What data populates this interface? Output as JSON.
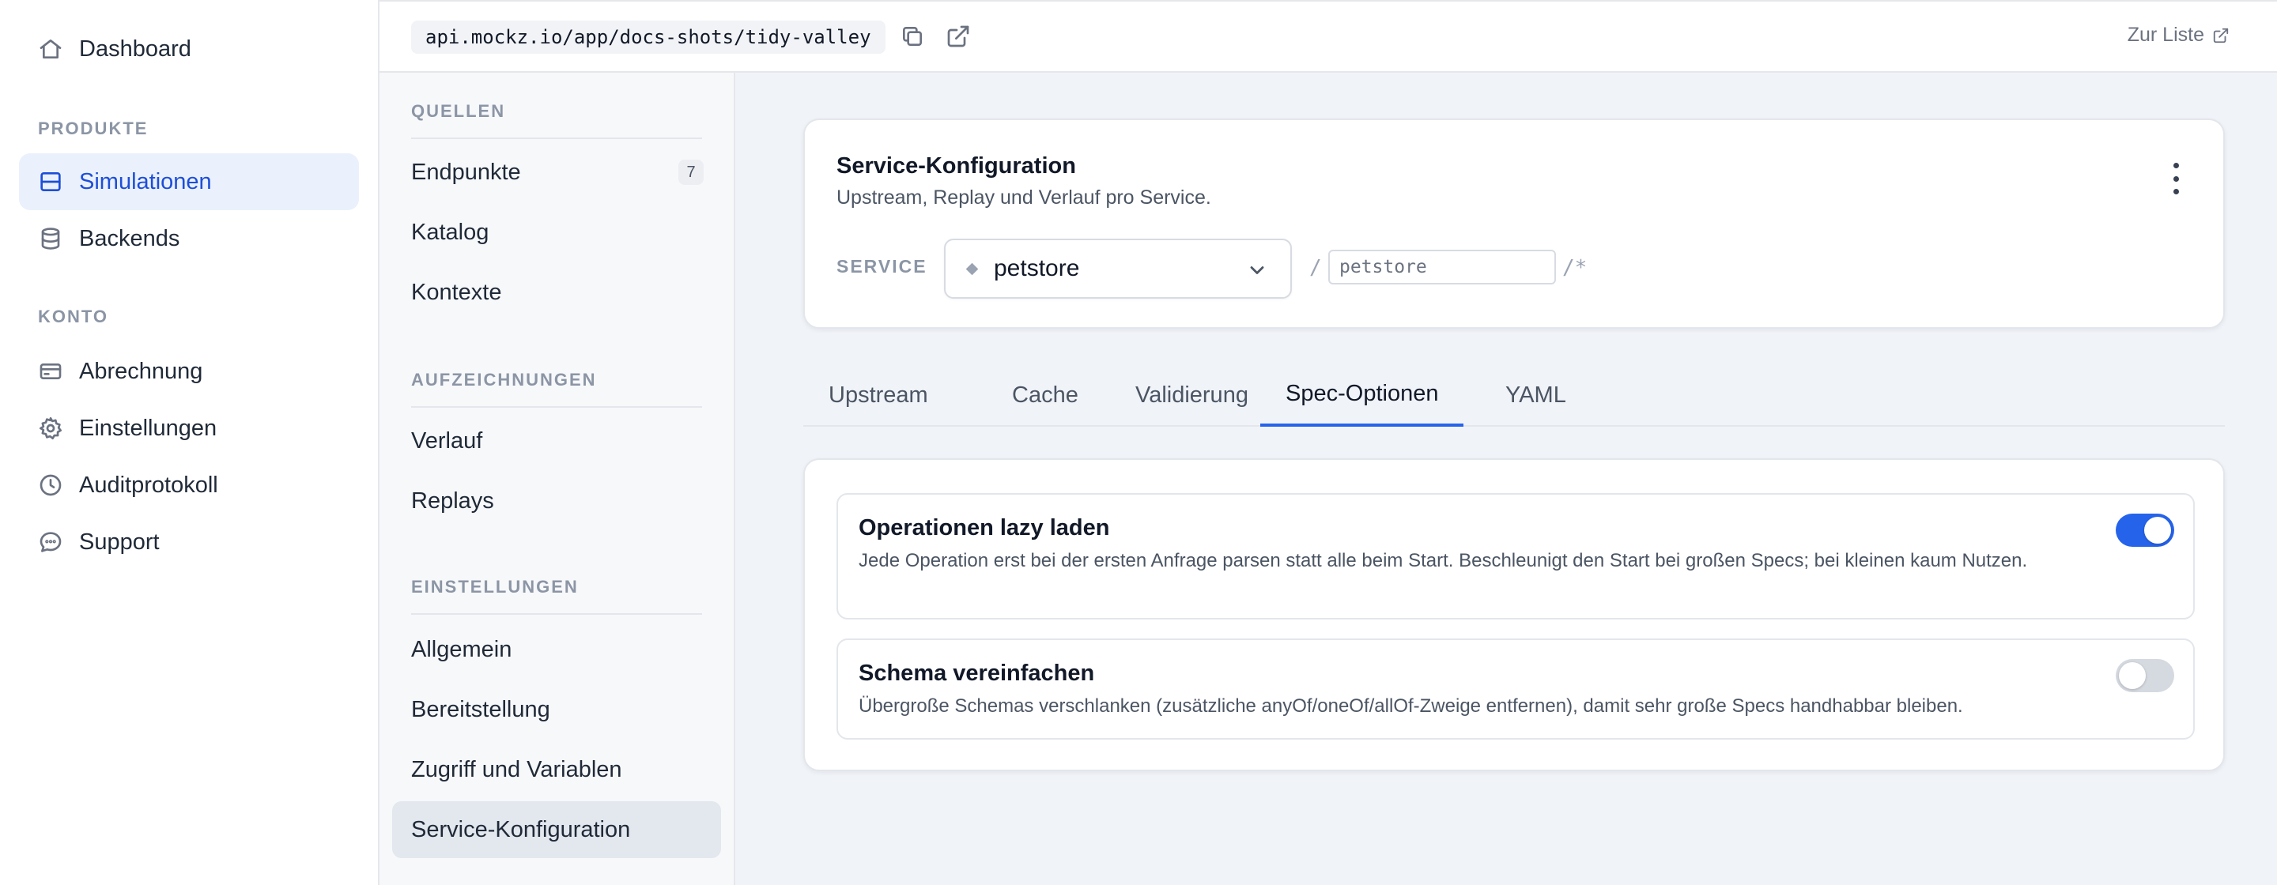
{
  "sidebar": {
    "items_top": [
      {
        "label": "Dashboard",
        "icon": "home-icon"
      }
    ],
    "section_products": "PRODUKTE",
    "items_products": [
      {
        "label": "Simulationen",
        "icon": "layout-icon",
        "active": true
      },
      {
        "label": "Backends",
        "icon": "database-icon"
      }
    ],
    "section_account": "KONTO",
    "items_account": [
      {
        "label": "Abrechnung",
        "icon": "credit-card-icon"
      },
      {
        "label": "Einstellungen",
        "icon": "gear-icon"
      },
      {
        "label": "Auditprotokoll",
        "icon": "clock-icon"
      },
      {
        "label": "Support",
        "icon": "chat-icon"
      }
    ]
  },
  "topbar": {
    "url": "api.mockz.io/app/docs-shots/tidy-valley",
    "to_list": "Zur Liste"
  },
  "subnav": {
    "sources_heading": "QUELLEN",
    "sources": [
      {
        "label": "Endpunkte",
        "badge": "7"
      },
      {
        "label": "Katalog"
      },
      {
        "label": "Kontexte"
      }
    ],
    "recordings_heading": "AUFZEICHNUNGEN",
    "recordings": [
      {
        "label": "Verlauf"
      },
      {
        "label": "Replays"
      }
    ],
    "settings_heading": "EINSTELLUNGEN",
    "settings": [
      {
        "label": "Allgemein"
      },
      {
        "label": "Bereitstellung"
      },
      {
        "label": "Zugriff und Variablen"
      },
      {
        "label": "Service-Konfiguration",
        "active": true
      }
    ]
  },
  "service_card": {
    "title": "Service-Konfiguration",
    "subtitle": "Upstream, Replay und Verlauf pro Service.",
    "service_label": "SERVICE",
    "service_value": "petstore",
    "path_prefix": "/",
    "path_value": "petstore",
    "path_suffix": "/*"
  },
  "tabs": [
    {
      "label": "Upstream"
    },
    {
      "label": "Cache"
    },
    {
      "label": "Validierung"
    },
    {
      "label": "Spec-Optionen",
      "active": true
    },
    {
      "label": "YAML"
    }
  ],
  "options": [
    {
      "title": "Operationen lazy laden",
      "description": "Jede Operation erst bei der ersten Anfrage parsen statt alle beim Start. Beschleunigt den Start bei großen Specs; bei kleinen kaum Nutzen.",
      "enabled": true
    },
    {
      "title": "Schema vereinfachen",
      "description": "Übergroße Schemas verschlanken (zusätzliche anyOf/oneOf/allOf-Zweige entfernen), damit sehr große Specs handhabbar bleiben.",
      "enabled": false
    }
  ],
  "colors": {
    "accent": "#2563eb",
    "active_nav_bg": "#eaf1fc",
    "page_bg": "#f0f3f8"
  }
}
